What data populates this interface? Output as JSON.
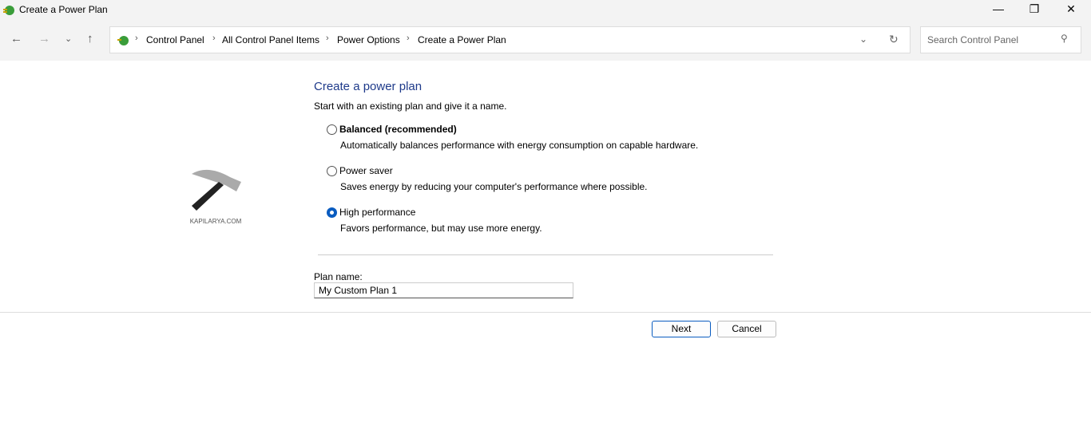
{
  "window": {
    "title": "Create a Power Plan",
    "min": "—",
    "max": "❐",
    "close": "✕"
  },
  "nav": {
    "back": "←",
    "forward": "→",
    "recent": "⌄",
    "up": "↑"
  },
  "breadcrumb": [
    "Control Panel",
    "All Control Panel Items",
    "Power Options",
    "Create a Power Plan"
  ],
  "search": {
    "placeholder": "Search Control Panel"
  },
  "logo": {
    "text": "KAPILARYA.COM"
  },
  "main": {
    "title": "Create a power plan",
    "subtitle": "Start with an existing plan and give it a name.",
    "plans": [
      {
        "label": "Balanced (recommended)",
        "desc": "Automatically balances performance with energy consumption on capable hardware.",
        "selected": false
      },
      {
        "label": "Power saver",
        "desc": "Saves energy by reducing your computer's performance where possible.",
        "selected": false
      },
      {
        "label": "High performance",
        "desc": "Favors performance, but may use more energy.",
        "selected": true
      }
    ],
    "plan_name_label": "Plan name:",
    "plan_name_value": "My Custom Plan 1",
    "next": "Next",
    "cancel": "Cancel"
  }
}
